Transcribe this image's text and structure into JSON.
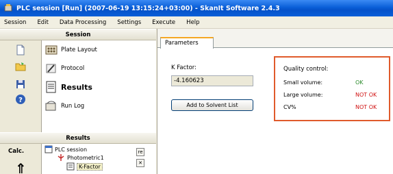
{
  "window": {
    "title": "PLC session [Run] (2007-06-19 13:15:24+03:00) - SkanIt Software 2.4.3"
  },
  "menu": [
    {
      "label": "Session",
      "underline": "S"
    },
    {
      "label": "Edit",
      "underline": "E"
    },
    {
      "label": "Data Processing",
      "underline": "D"
    },
    {
      "label": "Settings",
      "underline": ""
    },
    {
      "label": "Execute",
      "underline": "x"
    },
    {
      "label": "Help",
      "underline": "H"
    }
  ],
  "session_panel": {
    "header": "Session",
    "tools": [
      "new-document-icon",
      "open-folder-icon",
      "save-disk-icon",
      "help-icon"
    ],
    "items": [
      {
        "label": "Plate Layout",
        "icon": "plate-layout-icon"
      },
      {
        "label": "Protocol",
        "icon": "protocol-icon"
      },
      {
        "label": "Results",
        "icon": "results-icon",
        "selected": true
      },
      {
        "label": "Run Log",
        "icon": "run-log-icon"
      }
    ]
  },
  "results_panel": {
    "header": "Results",
    "calc_label": "Calc.",
    "tree": [
      {
        "label": "PLC session",
        "level": 0
      },
      {
        "label": "Photometric1",
        "level": 1
      },
      {
        "label": "K-Factor",
        "level": 2,
        "selected": true
      }
    ]
  },
  "main": {
    "tab": "Parameters",
    "kfactor_label": "K Factor:",
    "kfactor_value": "-4.160623",
    "add_button": "Add to Solvent List",
    "quality": {
      "title": "Quality control:",
      "rows": [
        {
          "label": "Small volume:",
          "status": "OK",
          "color": "#2a8a2a"
        },
        {
          "label": "Large volume:",
          "status": "NOT OK",
          "color": "#d01010"
        },
        {
          "label": "CV%",
          "status": "NOT OK",
          "color": "#d01010"
        }
      ]
    }
  },
  "colors": {
    "highlight_box": "#e05a2b",
    "titlebar": "#0a5fd8"
  }
}
